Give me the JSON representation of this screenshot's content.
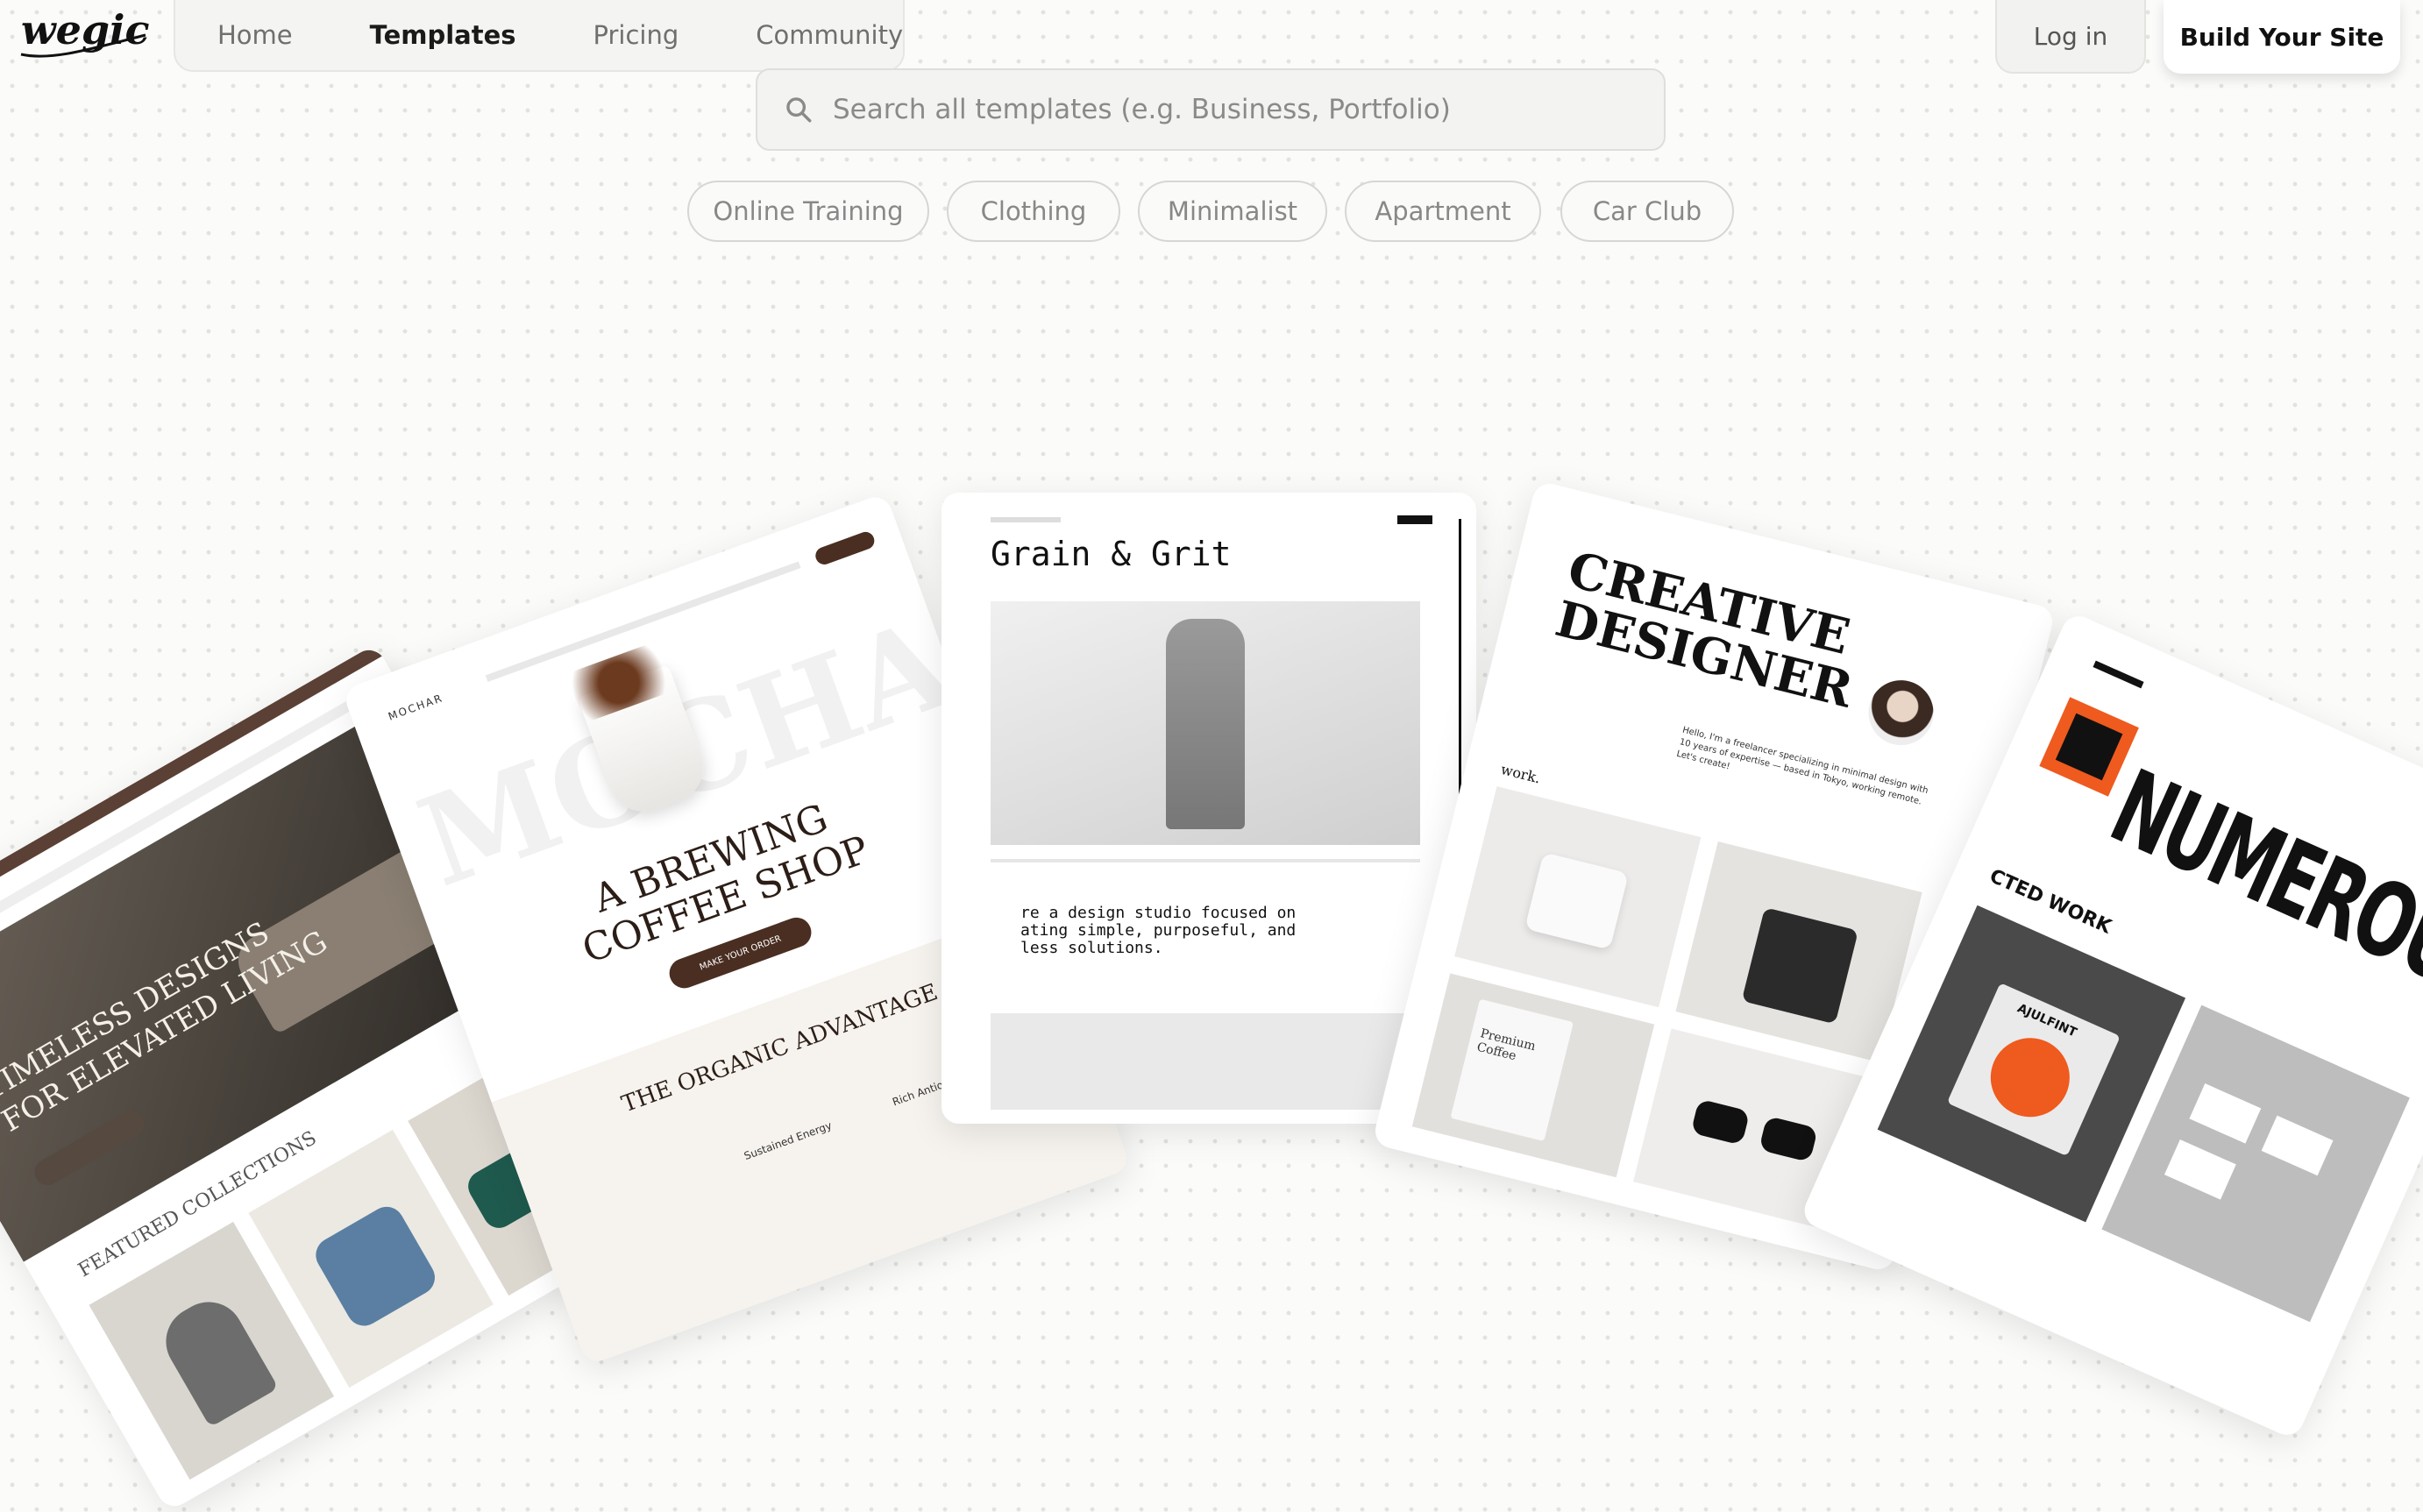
{
  "header": {
    "logo_text": "wegic",
    "nav": [
      "Home",
      "Templates",
      "Pricing",
      "Community"
    ],
    "login_label": "Log in",
    "build_label": "Build Your Site"
  },
  "search": {
    "placeholder": "Search all templates (e.g. Business, Portfolio)"
  },
  "chips": [
    "Online Training",
    "Clothing",
    "Minimalist",
    "Apartment",
    "Car Club"
  ],
  "templates": {
    "furniture": {
      "headline_1": "TIMELESS DESIGNS",
      "headline_2": "FOR ELEVATED LIVING",
      "section": "FEATURED COLLECTIONS"
    },
    "coffee": {
      "brand": "MOCHAR",
      "headline_1": "A BREWING",
      "headline_2": "COFFEE SHOP",
      "cta": "MAKE YOUR ORDER",
      "section": "THE ORGANIC ADVANTAGE",
      "feature_1": "Sustained Energy",
      "feature_2": "Rich Antioxidants"
    },
    "grain": {
      "title": "Grain & Grit",
      "body": "re a design studio focused on\nating simple, purposeful, and\nless solutions."
    },
    "designer": {
      "headline_1": "CREATIVE",
      "headline_2": "DESIGNER",
      "work_label": "work.",
      "intro": "Hello, I'm a freelancer specializing in minimal design with 10 years of expertise — based in Tokyo, working remote. Let's create!",
      "bag_text": "Premium Coffee"
    },
    "numerous": {
      "headline": "NUMEROUS",
      "section": "CTED WORK",
      "card_text": "AJULFINT"
    }
  },
  "colors": {
    "accent_dark": "#111111",
    "nav_bg": "#f4f4f2",
    "coffee_brown": "#4a2e22",
    "orange": "#ef5a1e"
  }
}
